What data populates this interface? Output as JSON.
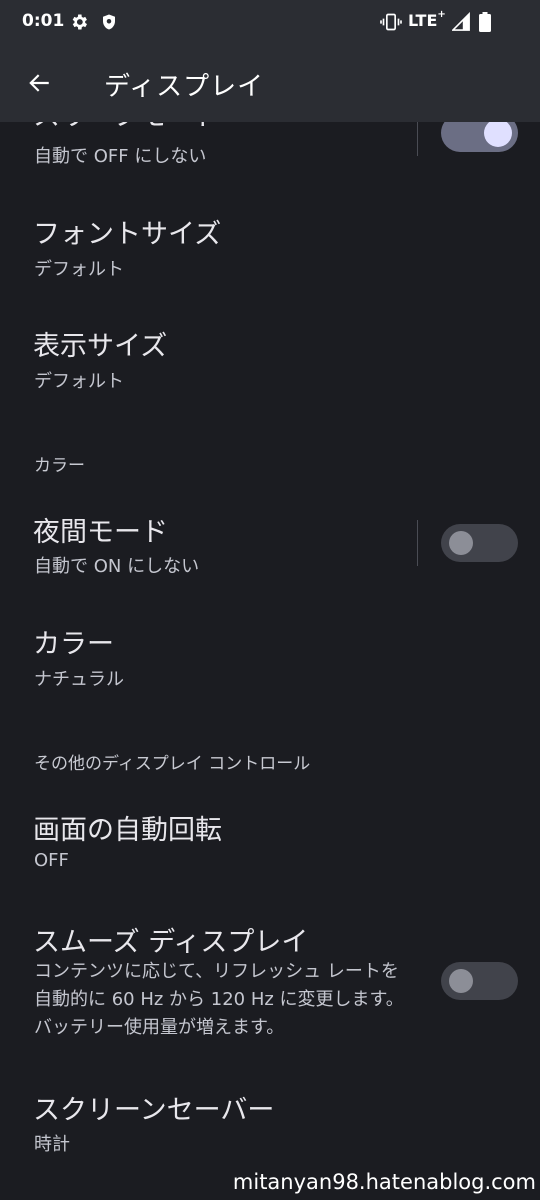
{
  "status_bar": {
    "time": "0:01",
    "network": "LTE",
    "network_sup": "+",
    "icons": [
      "gear-icon",
      "shield-icon",
      "vibrate-icon",
      "signal-icon",
      "battery-icon"
    ]
  },
  "app_bar": {
    "title": "ディスプレイ",
    "back_icon": "arrow-back-icon"
  },
  "settings": {
    "top_partial": {
      "title": "スリープモード",
      "summary": "自動で OFF にしない",
      "switch_on": true
    },
    "font_size": {
      "title": "フォントサイズ",
      "summary": "デフォルト"
    },
    "display_size": {
      "title": "表示サイズ",
      "summary": "デフォルト"
    },
    "section_color": "カラー",
    "night_mode": {
      "title": "夜間モード",
      "summary": "自動で ON にしない",
      "switch_on": false
    },
    "color": {
      "title": "カラー",
      "summary": "ナチュラル"
    },
    "section_other": "その他のディスプレイ コントロール",
    "auto_rotate": {
      "title": "画面の自動回転",
      "summary": "OFF"
    },
    "smooth_display": {
      "title": "スムーズ ディスプレイ",
      "description": "コンテンツに応じて、リフレッシュ レートを自動的に 60 Hz から 120 Hz に変更します。バッテリー使用量が増えます。",
      "switch_on": false
    },
    "screensaver": {
      "title": "スクリーンセーバー",
      "summary": "時計"
    }
  },
  "watermark": "mitanyan98.hatenablog.com",
  "colors": {
    "background": "#1b1c21",
    "app_bar": "#2b2d33",
    "switch_on_track": "#6b6e84",
    "switch_on_knob": "#e0e0ff",
    "switch_off_track": "#41434b",
    "switch_off_knob": "#8c8e97"
  }
}
